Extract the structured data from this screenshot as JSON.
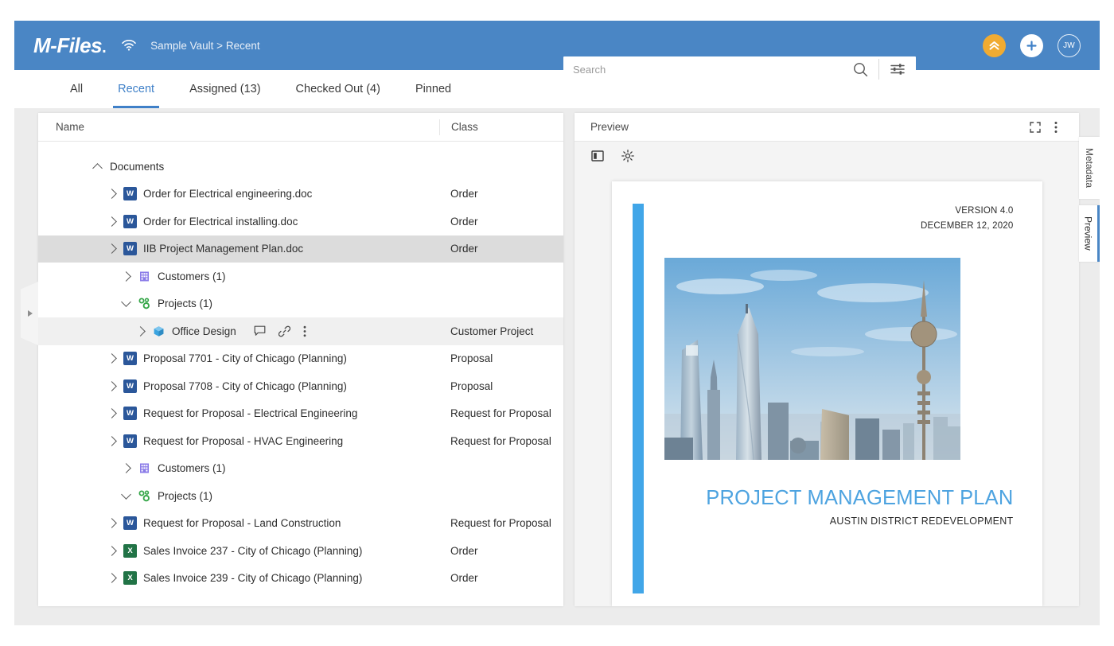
{
  "header": {
    "logo": "M-Files",
    "wifi_icon": "wifi-icon",
    "breadcrumb": "Sample Vault > Recent",
    "accent_color": "#4a86c5",
    "checkin_icon": "chevron-up-circle-icon",
    "add_icon": "plus-icon",
    "avatar_initials": "JW"
  },
  "search": {
    "placeholder": "Search",
    "value": "",
    "search_icon": "search-icon",
    "filter_icon": "filter-sliders-icon"
  },
  "tabs": [
    {
      "label": "All",
      "active": false
    },
    {
      "label": "Recent",
      "active": true
    },
    {
      "label": "Assigned (13)",
      "active": false
    },
    {
      "label": "Checked Out (4)",
      "active": false
    },
    {
      "label": "Pinned",
      "active": false
    }
  ],
  "list": {
    "columns": {
      "name": "Name",
      "class": "Class"
    },
    "rows": [
      {
        "label": "Documents",
        "class": "",
        "icon": "",
        "indent": 0,
        "caret": "up",
        "state": "normal"
      },
      {
        "label": "Order for Electrical engineering.doc",
        "class": "Order",
        "icon": "word",
        "indent": 1,
        "caret": "right",
        "state": "normal"
      },
      {
        "label": "Order for Electrical installing.doc",
        "class": "Order",
        "icon": "word",
        "indent": 1,
        "caret": "right",
        "state": "normal"
      },
      {
        "label": "IIB Project Management Plan.doc",
        "class": "Order",
        "icon": "word",
        "indent": 1,
        "caret": "right",
        "state": "selected"
      },
      {
        "label": "Customers (1)",
        "class": "",
        "icon": "building",
        "indent": 2,
        "caret": "right",
        "state": "normal"
      },
      {
        "label": "Projects (1)",
        "class": "",
        "icon": "nodes",
        "indent": 2,
        "caret": "down",
        "state": "normal"
      },
      {
        "label": "Office Design",
        "class": "Customer Project",
        "icon": "cube",
        "indent": 3,
        "caret": "right",
        "state": "subselected",
        "actions": [
          "comment-icon",
          "link-icon",
          "more-vertical-icon"
        ]
      },
      {
        "label": "Proposal 7701 - City of Chicago (Planning)",
        "class": "Proposal",
        "icon": "word",
        "indent": 1,
        "caret": "right",
        "state": "normal"
      },
      {
        "label": "Proposal 7708 - City of Chicago (Planning)",
        "class": "Proposal",
        "icon": "word",
        "indent": 1,
        "caret": "right",
        "state": "normal"
      },
      {
        "label": "Request for Proposal - Electrical Engineering",
        "class": "Request for Proposal",
        "icon": "word",
        "indent": 1,
        "caret": "right",
        "state": "normal"
      },
      {
        "label": "Request for Proposal - HVAC Engineering",
        "class": "Request for Proposal",
        "icon": "word",
        "indent": 1,
        "caret": "right",
        "state": "normal"
      },
      {
        "label": "Customers (1)",
        "class": "",
        "icon": "building",
        "indent": 2,
        "caret": "right",
        "state": "normal"
      },
      {
        "label": "Projects (1)",
        "class": "",
        "icon": "nodes",
        "indent": 2,
        "caret": "down",
        "state": "normal"
      },
      {
        "label": "Request for Proposal - Land Construction",
        "class": "Request for Proposal",
        "icon": "word",
        "indent": 1,
        "caret": "right",
        "state": "normal"
      },
      {
        "label": "Sales Invoice 237 - City of Chicago (Planning)",
        "class": "Order",
        "icon": "excel",
        "indent": 1,
        "caret": "right",
        "state": "normal"
      },
      {
        "label": "Sales Invoice 239 - City of Chicago (Planning)",
        "class": "Order",
        "icon": "excel",
        "indent": 1,
        "caret": "right",
        "state": "normal"
      }
    ]
  },
  "preview": {
    "title": "Preview",
    "fullscreen_icon": "fullscreen-icon",
    "more_icon": "more-vertical-icon",
    "toolbar": {
      "layout_icon": "sidebar-toggle-icon",
      "settings_icon": "gear-icon"
    },
    "document": {
      "version": "VERSION 4.0",
      "date": "DECEMBER 12, 2020",
      "title": "PROJECT MANAGEMENT PLAN",
      "subtitle": "AUSTIN DISTRICT REDEVELOPMENT",
      "accent_color": "#41a6e8",
      "title_color": "#4da3e0",
      "photo_alt": "city-skyline-photo"
    }
  },
  "side_tabs": [
    {
      "label": "Metadata",
      "active": false
    },
    {
      "label": "Preview",
      "active": true
    }
  ],
  "left_rail": {
    "expand_icon": "expand-panel-icon"
  }
}
